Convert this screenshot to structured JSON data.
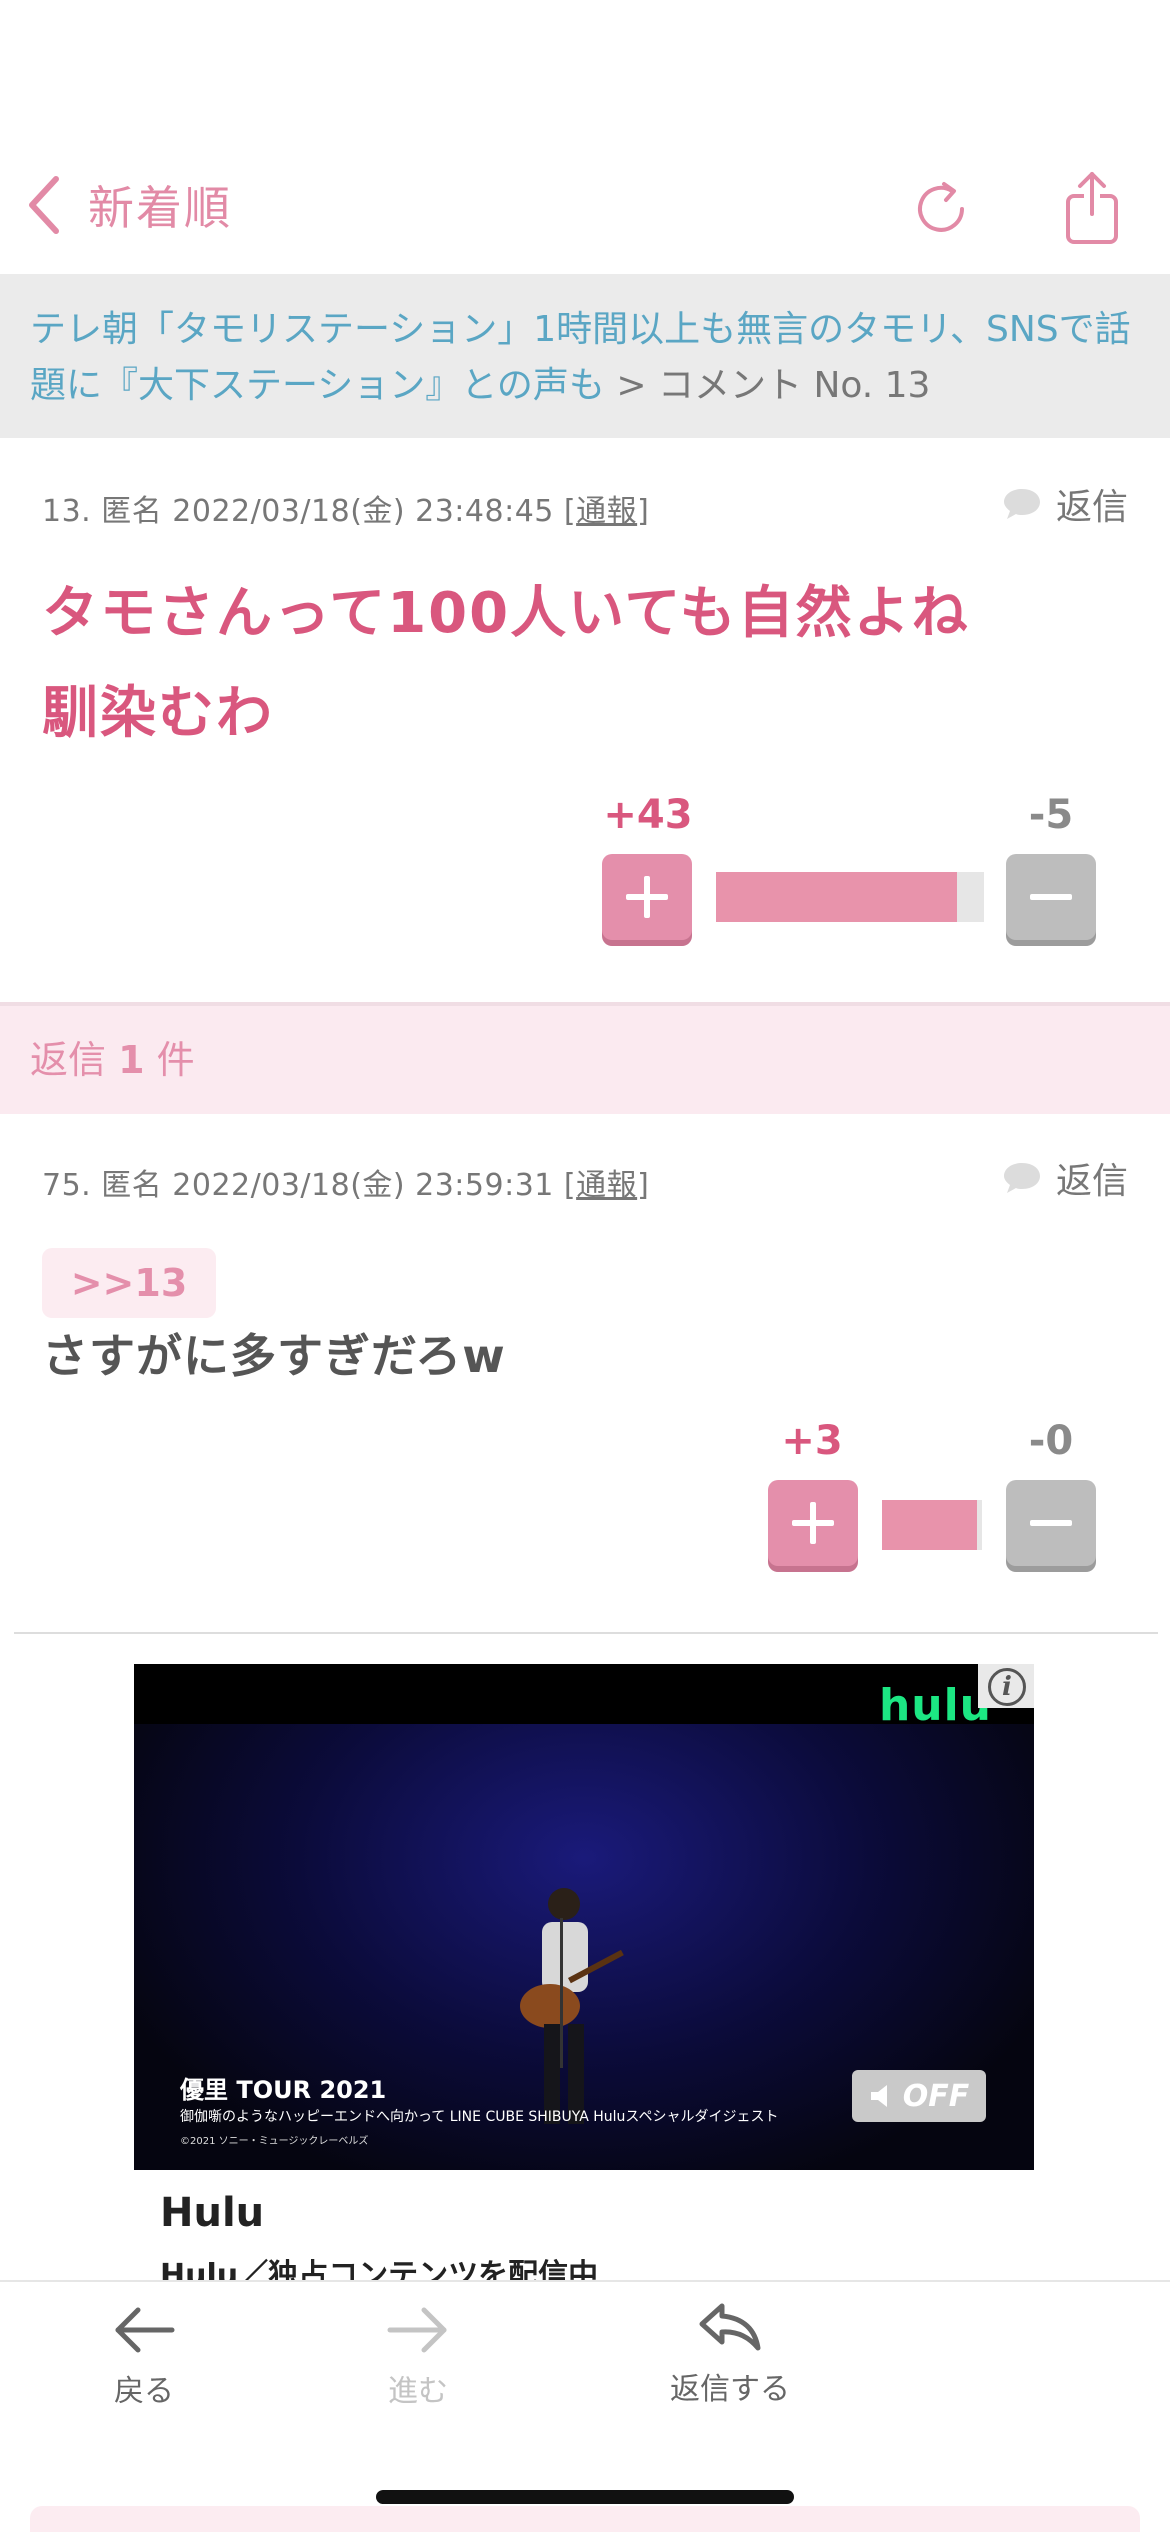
{
  "nav": {
    "back_label": "新着順"
  },
  "breadcrumb": {
    "topic_title": "テレ朝「タモリステーション」1時間以上も無言のタモリ、SNSで話題に『大下ステーション』との声も",
    "separator": ">",
    "current": "コメント No. 13"
  },
  "comment_main": {
    "meta_prefix": "13. 匿名 2022/03/18(金) 23:48:45 [",
    "report_label": "通報",
    "meta_suffix": "]",
    "reply_label": "返信",
    "body_line1": "タモさんって100人いても自然よね",
    "body_line2": "馴染むわ",
    "plus_count": "+43",
    "minus_count": "-5",
    "plus_ratio": 0.9
  },
  "replies_header": {
    "prefix": "返信",
    "count": "1",
    "suffix": "件"
  },
  "comment_reply": {
    "meta_prefix": "75. 匿名 2022/03/18(金) 23:59:31 [",
    "report_label": "通報",
    "meta_suffix": "]",
    "reply_label": "返信",
    "anchor": ">>13",
    "body": "さすがに多すぎだろw",
    "plus_count": "+3",
    "minus_count": "-0",
    "plus_ratio": 0.95
  },
  "ad": {
    "logo": "hulu",
    "video_title": "優里 TOUR 2021",
    "video_subtitle": "御伽噺のようなハッピーエンドへ向かって LINE CUBE SHIBUYA Huluスペシャルダイジェスト",
    "video_copyright": "©2021 ソニー・ミュージックレーベルズ",
    "mute_label": "OFF",
    "advertiser": "Hulu",
    "description": "Hulu／独占コンテンツを配信中"
  },
  "toolbar": {
    "back_label": "戻る",
    "forward_label": "進む",
    "reply_label": "返信する"
  },
  "colors": {
    "accent_pink": "#d9577e",
    "button_pink": "#e48fab",
    "link_blue": "#5aa6c4",
    "gray_button": "#bdbdbd"
  }
}
